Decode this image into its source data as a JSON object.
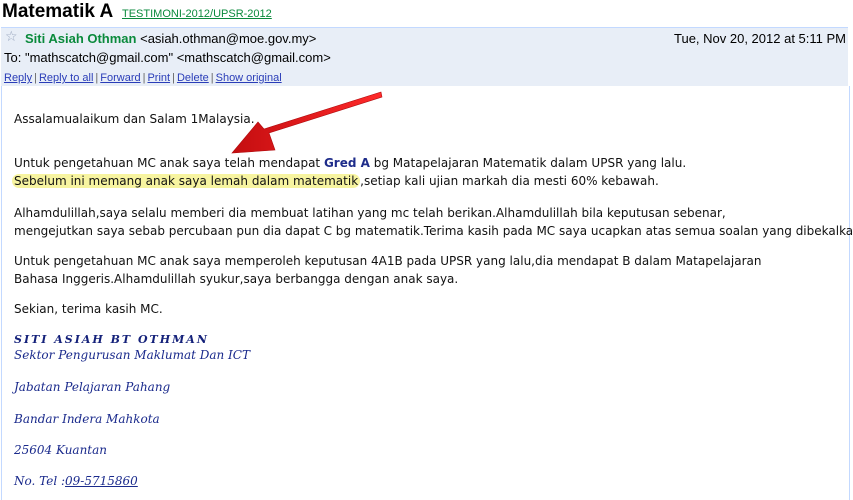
{
  "subject": "Matematik A",
  "label": "TESTIMONI-2012/UPSR-2012",
  "sender": {
    "name": "Siti Asiah Othman",
    "email": "<asiah.othman@moe.gov.my>",
    "date": "Tue, Nov 20, 2012 at 5:11 PM",
    "to": "To: \"mathscatch@gmail.com\" <mathscatch@gmail.com>"
  },
  "actions": [
    "Reply",
    "Reply to all",
    "Forward",
    "Print",
    "Delete",
    "Show original"
  ],
  "actions_sep": "|",
  "body": {
    "greeting": "Assalamualaikum dan Salam 1Malaysia.",
    "p1_pre": "Untuk pengetahuan MC anak saya telah mendapat ",
    "p1_bold": "Gred A",
    "p1_post": " bg Matapelajaran Matematik dalam UPSR yang lalu.",
    "p1_highlight": "Sebelum ini memang anak saya lemah dalam matematik",
    "p1_rest": ",setiap kali ujian markah dia mesti 60% kebawah.",
    "p2_line1": "Alhamdulillah,saya selalu memberi dia membuat latihan yang mc telah berikan.Alhamdulillah bila keputusan sebenar,",
    "p2_line2": "mengejutkan saya sebab percubaan pun dia dapat C bg matematik.Terima kasih pada MC saya ucapkan atas semua soalan yang dibekalkan.",
    "p3_line1": "Untuk pengetahuan MC anak saya memperoleh keputusan 4A1B pada UPSR yang lalu,dia mendapat B dalam Matapelajaran",
    "p3_line2": "Bahasa Inggeris.Alhamdulillah syukur,saya berbangga dengan anak saya.",
    "closing": "Sekian, terima kasih MC."
  },
  "signature": {
    "name": "SITI ASIAH BT OTHMAN",
    "line1": "Sektor Pengurusan Maklumat Dan ICT",
    "line2": "Jabatan Pelajaran Pahang",
    "line3": "Bandar Indera Mahkota",
    "line4": "25604 Kuantan",
    "tel_label": "No. Tel :",
    "tel": "09-5715860"
  },
  "colors": {
    "sender_green": "#0a8a3c",
    "header_bg": "#e8eef7",
    "highlight": "#f7f4a0",
    "arrow_red": "#e8171b",
    "signature_blue": "#1a2a8c"
  },
  "icons": [
    "star-icon",
    "annotation-arrow"
  ]
}
